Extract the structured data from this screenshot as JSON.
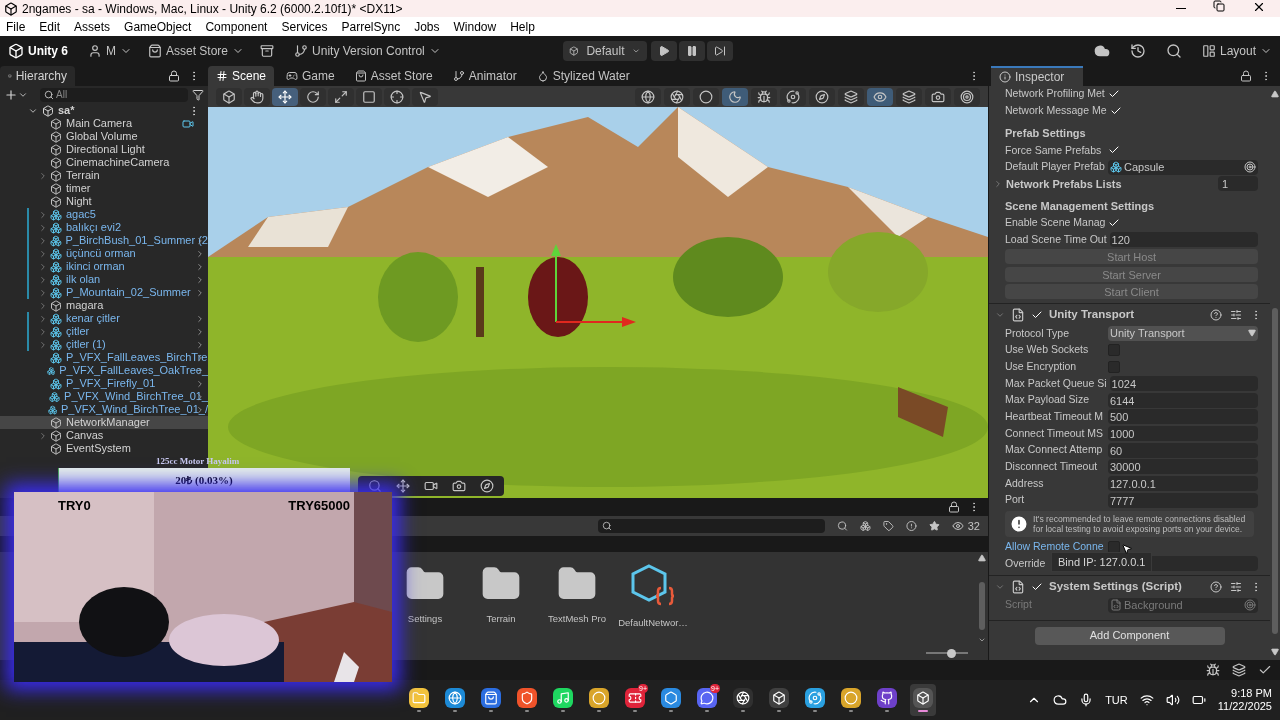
{
  "window": {
    "title": "2ngames - sa - Windows, Mac, Linux - Unity 6.2 (6000.2.10f1)* <DX11>"
  },
  "menu": [
    "File",
    "Edit",
    "Assets",
    "GameObject",
    "Component",
    "Services",
    "ParrelSync",
    "Jobs",
    "Window",
    "Help"
  ],
  "toolbar": {
    "product": "Unity 6",
    "account": "M",
    "asset_store": "Asset Store",
    "version_control": "Unity Version Control",
    "layout_preset": "Default",
    "layout": "Layout"
  },
  "hierarchy": {
    "title": "Hierarchy",
    "search": {
      "placeholder": "All"
    },
    "scene": "sa*",
    "items": [
      {
        "name": "Main Camera",
        "kind": "object",
        "foldout": false,
        "modified": false,
        "gizmo": true,
        "selected": false
      },
      {
        "name": "Global Volume",
        "kind": "object",
        "foldout": false,
        "modified": false,
        "gizmo": false,
        "selected": false
      },
      {
        "name": "Directional Light",
        "kind": "object",
        "foldout": false,
        "modified": false,
        "gizmo": false,
        "selected": false
      },
      {
        "name": "CinemachineCamera",
        "kind": "object",
        "foldout": false,
        "modified": false,
        "gizmo": false,
        "selected": false
      },
      {
        "name": "Terrain",
        "kind": "object",
        "foldout": true,
        "modified": false,
        "gizmo": false,
        "selected": false
      },
      {
        "name": "timer",
        "kind": "object",
        "foldout": false,
        "modified": false,
        "gizmo": false,
        "selected": false
      },
      {
        "name": "Night",
        "kind": "object",
        "foldout": false,
        "modified": false,
        "gizmo": false,
        "selected": false
      },
      {
        "name": "agac5",
        "kind": "model",
        "foldout": true,
        "modified": true,
        "gizmo": false,
        "selected": false
      },
      {
        "name": "balıkçı evi2",
        "kind": "model",
        "foldout": true,
        "modified": true,
        "gizmo": false,
        "selected": false
      },
      {
        "name": "P_BirchBush_01_Summer (2",
        "kind": "prefab",
        "foldout": true,
        "modified": true,
        "gizmo": false,
        "selected": false
      },
      {
        "name": "üçüncü orman",
        "kind": "prefab",
        "foldout": true,
        "modified": true,
        "gizmo": false,
        "selected": false
      },
      {
        "name": "ikinci orman",
        "kind": "prefab",
        "foldout": true,
        "modified": true,
        "gizmo": false,
        "selected": false
      },
      {
        "name": "ilk olan",
        "kind": "prefab",
        "foldout": true,
        "modified": true,
        "gizmo": false,
        "selected": false
      },
      {
        "name": "P_Mountain_02_Summer",
        "kind": "prefab",
        "foldout": true,
        "modified": true,
        "gizmo": false,
        "selected": false
      },
      {
        "name": "magara",
        "kind": "object",
        "foldout": true,
        "modified": false,
        "gizmo": false,
        "selected": false
      },
      {
        "name": "kenar çitler",
        "kind": "prefab",
        "foldout": true,
        "modified": true,
        "gizmo": false,
        "selected": false
      },
      {
        "name": "çitler",
        "kind": "prefab",
        "foldout": true,
        "modified": true,
        "gizmo": false,
        "selected": false
      },
      {
        "name": "çitler (1)",
        "kind": "prefab",
        "foldout": true,
        "modified": true,
        "gizmo": false,
        "selected": false
      },
      {
        "name": "P_VFX_FallLeaves_BirchTre",
        "kind": "prefab",
        "foldout": false,
        "modified": false,
        "gizmo": false,
        "selected": false
      },
      {
        "name": "P_VFX_FallLeaves_OakTree_",
        "kind": "prefab",
        "foldout": false,
        "modified": false,
        "gizmo": false,
        "selected": false
      },
      {
        "name": "P_VFX_Firefly_01",
        "kind": "prefab",
        "foldout": false,
        "modified": false,
        "gizmo": false,
        "selected": false
      },
      {
        "name": "P_VFX_Wind_BirchTree_01_",
        "kind": "prefab",
        "foldout": false,
        "modified": false,
        "gizmo": false,
        "selected": false
      },
      {
        "name": "P_VFX_Wind_BirchTree_01_/",
        "kind": "prefab",
        "foldout": false,
        "modified": false,
        "gizmo": false,
        "selected": false
      },
      {
        "name": "NetworkManager",
        "kind": "object",
        "foldout": false,
        "modified": false,
        "gizmo": false,
        "selected": true
      },
      {
        "name": "Canvas",
        "kind": "object",
        "foldout": true,
        "modified": false,
        "gizmo": false,
        "selected": false
      },
      {
        "name": "EventSystem",
        "kind": "object",
        "foldout": false,
        "modified": false,
        "gizmo": false,
        "selected": false
      }
    ]
  },
  "scene_tabs": [
    {
      "label": "Scene",
      "selected": true
    },
    {
      "label": "Game",
      "selected": false
    },
    {
      "label": "Asset Store",
      "selected": false
    },
    {
      "label": "Animator",
      "selected": false
    },
    {
      "label": "Stylized Water",
      "selected": false
    }
  ],
  "scene_tools": [
    {
      "kind": "view",
      "selected": false
    },
    {
      "kind": "hand",
      "selected": false
    },
    {
      "kind": "move",
      "selected": true
    },
    {
      "kind": "rotate",
      "selected": false
    },
    {
      "kind": "scale",
      "selected": false
    },
    {
      "kind": "rect",
      "selected": false
    },
    {
      "kind": "transform",
      "selected": false
    },
    {
      "kind": "custom",
      "selected": false
    }
  ],
  "project": {
    "count": "32",
    "assets": [
      {
        "name": "Settings",
        "kind": "folder"
      },
      {
        "name": "Terrain",
        "kind": "folder"
      },
      {
        "name": "TextMesh Pro",
        "kind": "folder"
      },
      {
        "name": "DefaultNetwor…",
        "kind": "script"
      }
    ],
    "zoom": {
      "level": 0.6
    }
  },
  "inspector": {
    "title": "Inspector",
    "rows": [
      {
        "kind": "toggle",
        "label": "Network Profiling Met",
        "checked": true
      },
      {
        "kind": "toggle",
        "label": "Network Message Me",
        "checked": true
      },
      {
        "kind": "header",
        "label": "Prefab Settings"
      },
      {
        "kind": "toggle",
        "label": "Force Same Prefabs",
        "checked": true
      },
      {
        "kind": "object",
        "label": "Default Player Prefab",
        "value": "Capsule",
        "disabled": false
      },
      {
        "kind": "foldout",
        "label": "Network Prefabs Lists",
        "value": "1"
      },
      {
        "kind": "header",
        "label": "Scene Management Settings"
      },
      {
        "kind": "toggle",
        "label": "Enable Scene Manag",
        "checked": true
      },
      {
        "kind": "field",
        "label": "Load Scene Time Out",
        "value": "120"
      },
      {
        "kind": "button",
        "label": "Start Host",
        "disabled": true
      },
      {
        "kind": "button",
        "label": "Start Server",
        "disabled": true
      },
      {
        "kind": "button",
        "label": "Start Client",
        "disabled": true
      },
      {
        "kind": "component",
        "label": "Unity Transport",
        "enabled": true
      },
      {
        "kind": "dropdown",
        "label": "Protocol Type",
        "value": "Unity Transport"
      },
      {
        "kind": "toggle",
        "label": "Use Web Sockets",
        "checked": false
      },
      {
        "kind": "toggle",
        "label": "Use Encryption",
        "checked": false
      },
      {
        "kind": "field",
        "label": "Max Packet Queue Si",
        "value": "1024"
      },
      {
        "kind": "field",
        "label": "Max Payload Size",
        "value": "6144"
      },
      {
        "kind": "field",
        "label": "Heartbeat Timeout M",
        "value": "500"
      },
      {
        "kind": "field",
        "label": "Connect Timeout MS",
        "value": "1000"
      },
      {
        "kind": "field",
        "label": "Max Connect Attemp",
        "value": "60"
      },
      {
        "kind": "field",
        "label": "Disconnect Timeout",
        "value": "30000"
      },
      {
        "kind": "field",
        "label": "Address",
        "value": "127.0.0.1"
      },
      {
        "kind": "field",
        "label": "Port",
        "value": "7777"
      },
      {
        "kind": "help",
        "text": "It's recommended to leave remote connections disabled for local testing to avoid exposing ports on your device."
      },
      {
        "kind": "toggle",
        "label": "Allow Remote Conne",
        "checked": false,
        "tooltip": "Bind IP: 127.0.0.1"
      },
      {
        "kind": "field",
        "label": "Override"
      },
      {
        "kind": "component",
        "label": "System Settings (Script)",
        "enabled": true
      },
      {
        "kind": "object",
        "label": "Script",
        "value": "Background",
        "disabled": true
      }
    ],
    "add_button": "Add Component"
  },
  "stream_overlay": {
    "goal_title": "125cc Motor Hayalim",
    "goal_text": "20₺ (0.03%)",
    "level": 0.0003,
    "min": "TRY0",
    "max": "TRY65000"
  },
  "taskbar": {
    "apps": [
      {
        "kind": "explorer",
        "active": false
      },
      {
        "kind": "edge",
        "active": false
      },
      {
        "kind": "store",
        "active": false
      },
      {
        "kind": "brave",
        "active": false
      },
      {
        "kind": "spotify",
        "active": false
      },
      {
        "kind": "chrome",
        "active": false
      },
      {
        "kind": "ticket",
        "badge": "9+",
        "active": false
      },
      {
        "kind": "kodi",
        "active": false
      },
      {
        "kind": "discord",
        "badge": "9+",
        "active": false
      },
      {
        "kind": "obs",
        "active": false
      },
      {
        "kind": "hub",
        "active": false
      },
      {
        "kind": "orb",
        "active": false
      },
      {
        "kind": "chrome",
        "active": false
      },
      {
        "kind": "github",
        "active": false
      },
      {
        "kind": "unity",
        "active": true
      }
    ],
    "language": "TUR",
    "time": "9:18 PM",
    "date": "11/22/2025"
  }
}
